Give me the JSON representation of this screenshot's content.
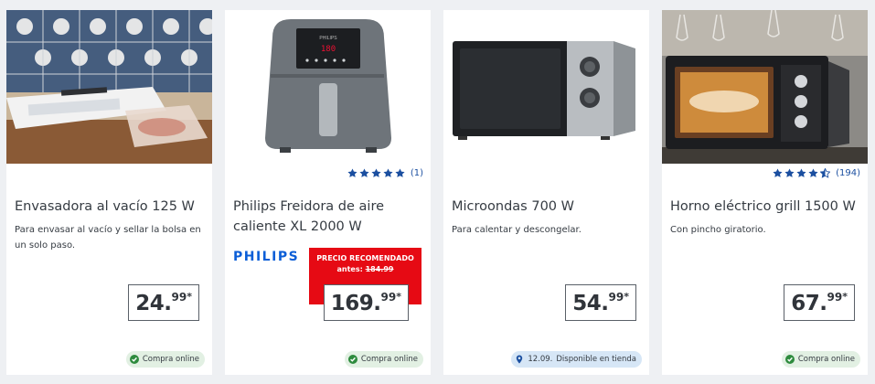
{
  "products": [
    {
      "title": "Envasadora al vacío 125 W",
      "description": "Para envasar al vacío y sellar la bolsa en un solo paso.",
      "price_main": "24.",
      "price_cents": "99",
      "price_asterisk": "*",
      "availability": "Compra online",
      "availability_icon": "check-circle-icon"
    },
    {
      "title": "Philips Freidora de aire caliente XL 2000 W",
      "brand": "PHILIPS",
      "rating_stars": 5,
      "rating_count": "(1)",
      "recommended_label": "PRECIO RECOMENDADO",
      "before_label": "antes: ",
      "before_price": "184.99",
      "price_main": "169.",
      "price_cents": "99",
      "price_asterisk": "*",
      "availability": "Compra online",
      "availability_icon": "check-circle-icon"
    },
    {
      "title": "Microondas 700 W",
      "description": "Para calentar y descongelar.",
      "price_main": "54.",
      "price_cents": "99",
      "price_asterisk": "*",
      "availability_date": "12.09.",
      "availability": "Disponible en tienda",
      "availability_icon": "location-pin-icon"
    },
    {
      "title": "Horno eléctrico grill 1500 W",
      "description": "Con pincho giratorio.",
      "rating_stars": 4.5,
      "rating_count": "(194)",
      "price_main": "67.",
      "price_cents": "99",
      "price_asterisk": "*",
      "availability": "Compra online",
      "availability_icon": "check-circle-icon"
    }
  ],
  "colors": {
    "star": "#1b4fa0",
    "price_badge_red": "#e60a14",
    "online_badge": "#e2f0e3",
    "store_badge": "#d6e6f6",
    "check_green": "#2e8b3e",
    "philips_blue": "#0b5ed7"
  }
}
